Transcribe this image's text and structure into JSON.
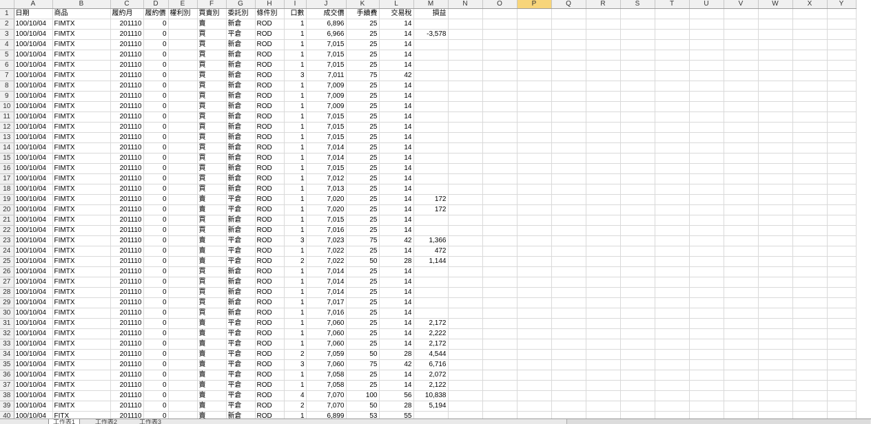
{
  "columns": [
    "A",
    "B",
    "C",
    "D",
    "E",
    "F",
    "G",
    "H",
    "I",
    "J",
    "K",
    "L",
    "M",
    "N",
    "O",
    "P",
    "Q",
    "R",
    "S",
    "T",
    "U",
    "V",
    "W",
    "X",
    "Y"
  ],
  "selected_column": "P",
  "header_row": [
    "日期",
    "商品",
    "履約月",
    "履約價",
    "權利別",
    "買賣別",
    "委託別",
    "條件別",
    "口數",
    "成交價",
    "手續費",
    "交易稅",
    "損益"
  ],
  "rows": [
    [
      "100/10/04",
      "FIMTX",
      "201110",
      "0",
      "",
      "賣",
      "新倉",
      "ROD",
      "1",
      "6,896",
      "25",
      "14",
      ""
    ],
    [
      "100/10/04",
      "FIMTX",
      "201110",
      "0",
      "",
      "買",
      "平倉",
      "ROD",
      "1",
      "6,966",
      "25",
      "14",
      "-3,578"
    ],
    [
      "100/10/04",
      "FIMTX",
      "201110",
      "0",
      "",
      "買",
      "新倉",
      "ROD",
      "1",
      "7,015",
      "25",
      "14",
      ""
    ],
    [
      "100/10/04",
      "FIMTX",
      "201110",
      "0",
      "",
      "買",
      "新倉",
      "ROD",
      "1",
      "7,015",
      "25",
      "14",
      ""
    ],
    [
      "100/10/04",
      "FIMTX",
      "201110",
      "0",
      "",
      "買",
      "新倉",
      "ROD",
      "1",
      "7,015",
      "25",
      "14",
      ""
    ],
    [
      "100/10/04",
      "FIMTX",
      "201110",
      "0",
      "",
      "買",
      "新倉",
      "ROD",
      "3",
      "7,011",
      "75",
      "42",
      ""
    ],
    [
      "100/10/04",
      "FIMTX",
      "201110",
      "0",
      "",
      "買",
      "新倉",
      "ROD",
      "1",
      "7,009",
      "25",
      "14",
      ""
    ],
    [
      "100/10/04",
      "FIMTX",
      "201110",
      "0",
      "",
      "買",
      "新倉",
      "ROD",
      "1",
      "7,009",
      "25",
      "14",
      ""
    ],
    [
      "100/10/04",
      "FIMTX",
      "201110",
      "0",
      "",
      "買",
      "新倉",
      "ROD",
      "1",
      "7,009",
      "25",
      "14",
      ""
    ],
    [
      "100/10/04",
      "FIMTX",
      "201110",
      "0",
      "",
      "買",
      "新倉",
      "ROD",
      "1",
      "7,015",
      "25",
      "14",
      ""
    ],
    [
      "100/10/04",
      "FIMTX",
      "201110",
      "0",
      "",
      "買",
      "新倉",
      "ROD",
      "1",
      "7,015",
      "25",
      "14",
      ""
    ],
    [
      "100/10/04",
      "FIMTX",
      "201110",
      "0",
      "",
      "買",
      "新倉",
      "ROD",
      "1",
      "7,015",
      "25",
      "14",
      ""
    ],
    [
      "100/10/04",
      "FIMTX",
      "201110",
      "0",
      "",
      "買",
      "新倉",
      "ROD",
      "1",
      "7,014",
      "25",
      "14",
      ""
    ],
    [
      "100/10/04",
      "FIMTX",
      "201110",
      "0",
      "",
      "買",
      "新倉",
      "ROD",
      "1",
      "7,014",
      "25",
      "14",
      ""
    ],
    [
      "100/10/04",
      "FIMTX",
      "201110",
      "0",
      "",
      "買",
      "新倉",
      "ROD",
      "1",
      "7,015",
      "25",
      "14",
      ""
    ],
    [
      "100/10/04",
      "FIMTX",
      "201110",
      "0",
      "",
      "買",
      "新倉",
      "ROD",
      "1",
      "7,012",
      "25",
      "14",
      ""
    ],
    [
      "100/10/04",
      "FIMTX",
      "201110",
      "0",
      "",
      "買",
      "新倉",
      "ROD",
      "1",
      "7,013",
      "25",
      "14",
      ""
    ],
    [
      "100/10/04",
      "FIMTX",
      "201110",
      "0",
      "",
      "賣",
      "平倉",
      "ROD",
      "1",
      "7,020",
      "25",
      "14",
      "172"
    ],
    [
      "100/10/04",
      "FIMTX",
      "201110",
      "0",
      "",
      "賣",
      "平倉",
      "ROD",
      "1",
      "7,020",
      "25",
      "14",
      "172"
    ],
    [
      "100/10/04",
      "FIMTX",
      "201110",
      "0",
      "",
      "買",
      "新倉",
      "ROD",
      "1",
      "7,015",
      "25",
      "14",
      ""
    ],
    [
      "100/10/04",
      "FIMTX",
      "201110",
      "0",
      "",
      "買",
      "新倉",
      "ROD",
      "1",
      "7,016",
      "25",
      "14",
      ""
    ],
    [
      "100/10/04",
      "FIMTX",
      "201110",
      "0",
      "",
      "賣",
      "平倉",
      "ROD",
      "3",
      "7,023",
      "75",
      "42",
      "1,366"
    ],
    [
      "100/10/04",
      "FIMTX",
      "201110",
      "0",
      "",
      "賣",
      "平倉",
      "ROD",
      "1",
      "7,022",
      "25",
      "14",
      "472"
    ],
    [
      "100/10/04",
      "FIMTX",
      "201110",
      "0",
      "",
      "賣",
      "平倉",
      "ROD",
      "2",
      "7,022",
      "50",
      "28",
      "1,144"
    ],
    [
      "100/10/04",
      "FIMTX",
      "201110",
      "0",
      "",
      "買",
      "新倉",
      "ROD",
      "1",
      "7,014",
      "25",
      "14",
      ""
    ],
    [
      "100/10/04",
      "FIMTX",
      "201110",
      "0",
      "",
      "買",
      "新倉",
      "ROD",
      "1",
      "7,014",
      "25",
      "14",
      ""
    ],
    [
      "100/10/04",
      "FIMTX",
      "201110",
      "0",
      "",
      "買",
      "新倉",
      "ROD",
      "1",
      "7,014",
      "25",
      "14",
      ""
    ],
    [
      "100/10/04",
      "FIMTX",
      "201110",
      "0",
      "",
      "買",
      "新倉",
      "ROD",
      "1",
      "7,017",
      "25",
      "14",
      ""
    ],
    [
      "100/10/04",
      "FIMTX",
      "201110",
      "0",
      "",
      "買",
      "新倉",
      "ROD",
      "1",
      "7,016",
      "25",
      "14",
      ""
    ],
    [
      "100/10/04",
      "FIMTX",
      "201110",
      "0",
      "",
      "賣",
      "平倉",
      "ROD",
      "1",
      "7,060",
      "25",
      "14",
      "2,172"
    ],
    [
      "100/10/04",
      "FIMTX",
      "201110",
      "0",
      "",
      "賣",
      "平倉",
      "ROD",
      "1",
      "7,060",
      "25",
      "14",
      "2,222"
    ],
    [
      "100/10/04",
      "FIMTX",
      "201110",
      "0",
      "",
      "賣",
      "平倉",
      "ROD",
      "1",
      "7,060",
      "25",
      "14",
      "2,172"
    ],
    [
      "100/10/04",
      "FIMTX",
      "201110",
      "0",
      "",
      "賣",
      "平倉",
      "ROD",
      "2",
      "7,059",
      "50",
      "28",
      "4,544"
    ],
    [
      "100/10/04",
      "FIMTX",
      "201110",
      "0",
      "",
      "賣",
      "平倉",
      "ROD",
      "3",
      "7,060",
      "75",
      "42",
      "6,716"
    ],
    [
      "100/10/04",
      "FIMTX",
      "201110",
      "0",
      "",
      "賣",
      "平倉",
      "ROD",
      "1",
      "7,058",
      "25",
      "14",
      "2,072"
    ],
    [
      "100/10/04",
      "FIMTX",
      "201110",
      "0",
      "",
      "賣",
      "平倉",
      "ROD",
      "1",
      "7,058",
      "25",
      "14",
      "2,122"
    ],
    [
      "100/10/04",
      "FIMTX",
      "201110",
      "0",
      "",
      "賣",
      "平倉",
      "ROD",
      "4",
      "7,070",
      "100",
      "56",
      "10,838"
    ],
    [
      "100/10/04",
      "FIMTX",
      "201110",
      "0",
      "",
      "賣",
      "平倉",
      "ROD",
      "2",
      "7,070",
      "50",
      "28",
      "5,194"
    ],
    [
      "100/10/04",
      "FITX",
      "201110",
      "0",
      "",
      "賣",
      "新倉",
      "ROD",
      "1",
      "6,899",
      "53",
      "55",
      ""
    ]
  ],
  "sheet_tabs": [
    "工作表1",
    "工作表2",
    "工作表3"
  ],
  "colors": {
    "header_bg": "#f0f0f0",
    "selected_header": "#f7d57a",
    "gridline": "#d9d9d9"
  }
}
